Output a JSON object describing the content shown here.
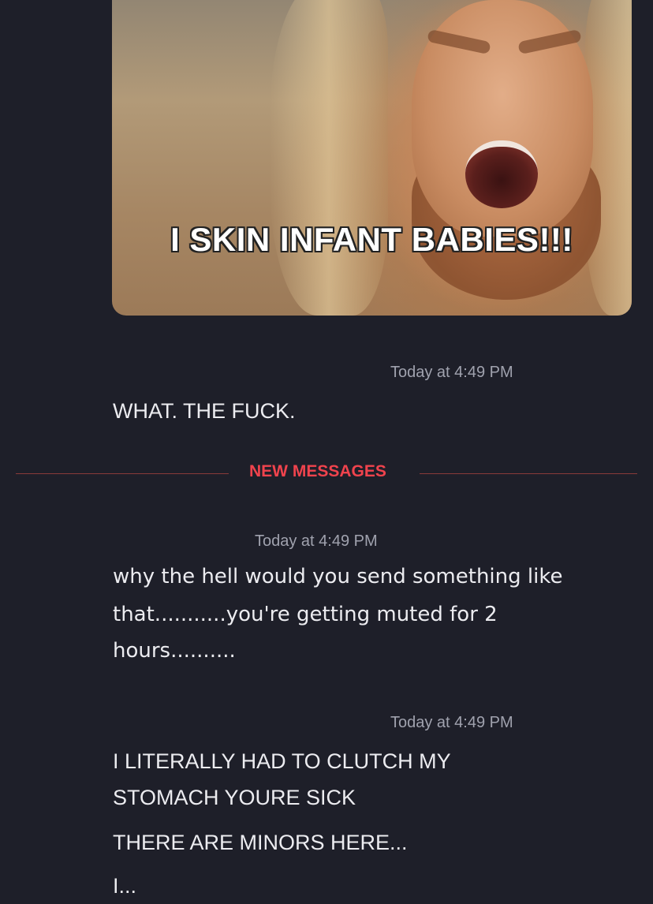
{
  "attachment": {
    "caption": "I SKIN INFANT BABIES!!!"
  },
  "messages": [
    {
      "timestamp": "Today at 4:49 PM",
      "lines": [
        "WHAT. THE FUCK."
      ]
    },
    {
      "timestamp": "Today at 4:49 PM",
      "lines": [
        "why the hell would you send something like",
        "that...........you're getting muted for 2",
        "hours.........."
      ]
    },
    {
      "timestamp": "Today at 4:49 PM",
      "lines": [
        "I LITERALLY HAD TO CLUTCH MY",
        "STOMACH YOURE SICK",
        "THERE ARE MINORS HERE...",
        "I..."
      ]
    }
  ],
  "divider": {
    "label": "NEW MESSAGES",
    "color": "#f0434d"
  },
  "colors": {
    "background": "#1e1f29",
    "text": "#ececf0",
    "timestamp": "#a0a2ae"
  }
}
